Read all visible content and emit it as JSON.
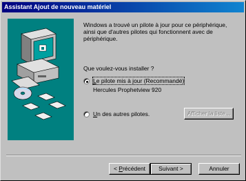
{
  "window": {
    "title": "Assistant Ajout de nouveau matériel"
  },
  "intro": {
    "line1": "Windows a trouvé un pilote à jour pour ce périphérique,",
    "line2": "ainsi que d'autres pilotes qui fonctionnent avec de",
    "line3": "périphérique."
  },
  "question": "Que voulez-vous installer ?",
  "options": [
    {
      "label_pre": "",
      "label_key": "L",
      "label_post": "e pilote mis à jour (Recommandé)",
      "detail": "Hercules Prophetview 920",
      "selected": true
    },
    {
      "label_pre": "",
      "label_key": "U",
      "label_post": "n des autres pilotes.",
      "selected": false
    }
  ],
  "show_list_button": "Afficher la liste...",
  "buttons": {
    "back_pre": "< ",
    "back_key": "P",
    "back_post": "récédent",
    "next": "Suivant >",
    "cancel": "Annuler"
  }
}
